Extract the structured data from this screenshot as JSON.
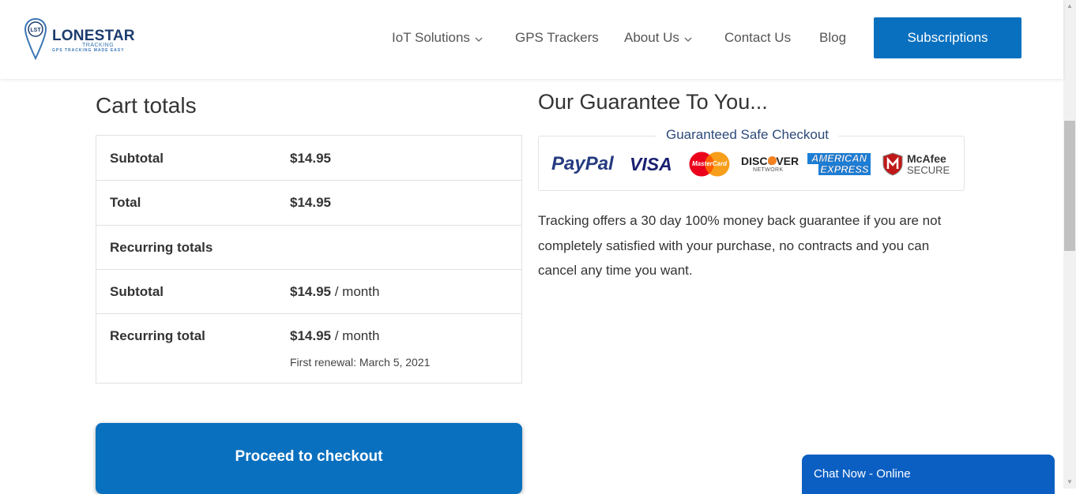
{
  "header": {
    "logo": {
      "name": "LONESTAR",
      "sub": "TRACKING",
      "tagline": "GPS TRACKING MADE EASY",
      "initials": "LST"
    },
    "nav": [
      {
        "label": "IoT Solutions",
        "dropdown": true
      },
      {
        "label": "GPS Trackers",
        "dropdown": false
      },
      {
        "label": "About Us",
        "dropdown": true
      },
      {
        "label": "Contact Us",
        "dropdown": false
      },
      {
        "label": "Blog",
        "dropdown": false
      }
    ],
    "subscriptions_label": "Subscriptions"
  },
  "cart": {
    "title": "Cart totals",
    "rows": [
      {
        "label": "Subtotal",
        "value": "$14.95",
        "suffix": ""
      },
      {
        "label": "Total",
        "value": "$14.95",
        "suffix": ""
      },
      {
        "label": "Recurring totals",
        "value": "",
        "suffix": ""
      },
      {
        "label": "Subtotal",
        "value": "$14.95",
        "suffix": "/ month"
      },
      {
        "label": "Recurring total",
        "value": "$14.95",
        "suffix": "/ month",
        "note": "First renewal: March 5, 2021"
      }
    ],
    "checkout_label": "Proceed to checkout"
  },
  "guarantee": {
    "title": "Our Guarantee To You...",
    "badge_caption": "Guaranteed Safe Checkout",
    "payment_logos": {
      "paypal": "PayPal",
      "visa": "VISA",
      "mastercard": "MasterCard",
      "discover": "DISCOVER",
      "discover_sub": "NETWORK",
      "amex_line1": "AMERICAN",
      "amex_line2": "EXPRESS",
      "mcafee": "McAfee",
      "mcafee_sub": "SECURE"
    },
    "text": "Tracking offers a 30 day 100% money back guarantee if you are not completely satisfied with your purchase, no contracts and you can cancel any time you want."
  },
  "chat": {
    "label": "Chat Now - Online"
  },
  "colors": {
    "brand_blue": "#0970bf",
    "chat_blue": "#0b5fc2",
    "logo_navy": "#1c3c6e"
  }
}
